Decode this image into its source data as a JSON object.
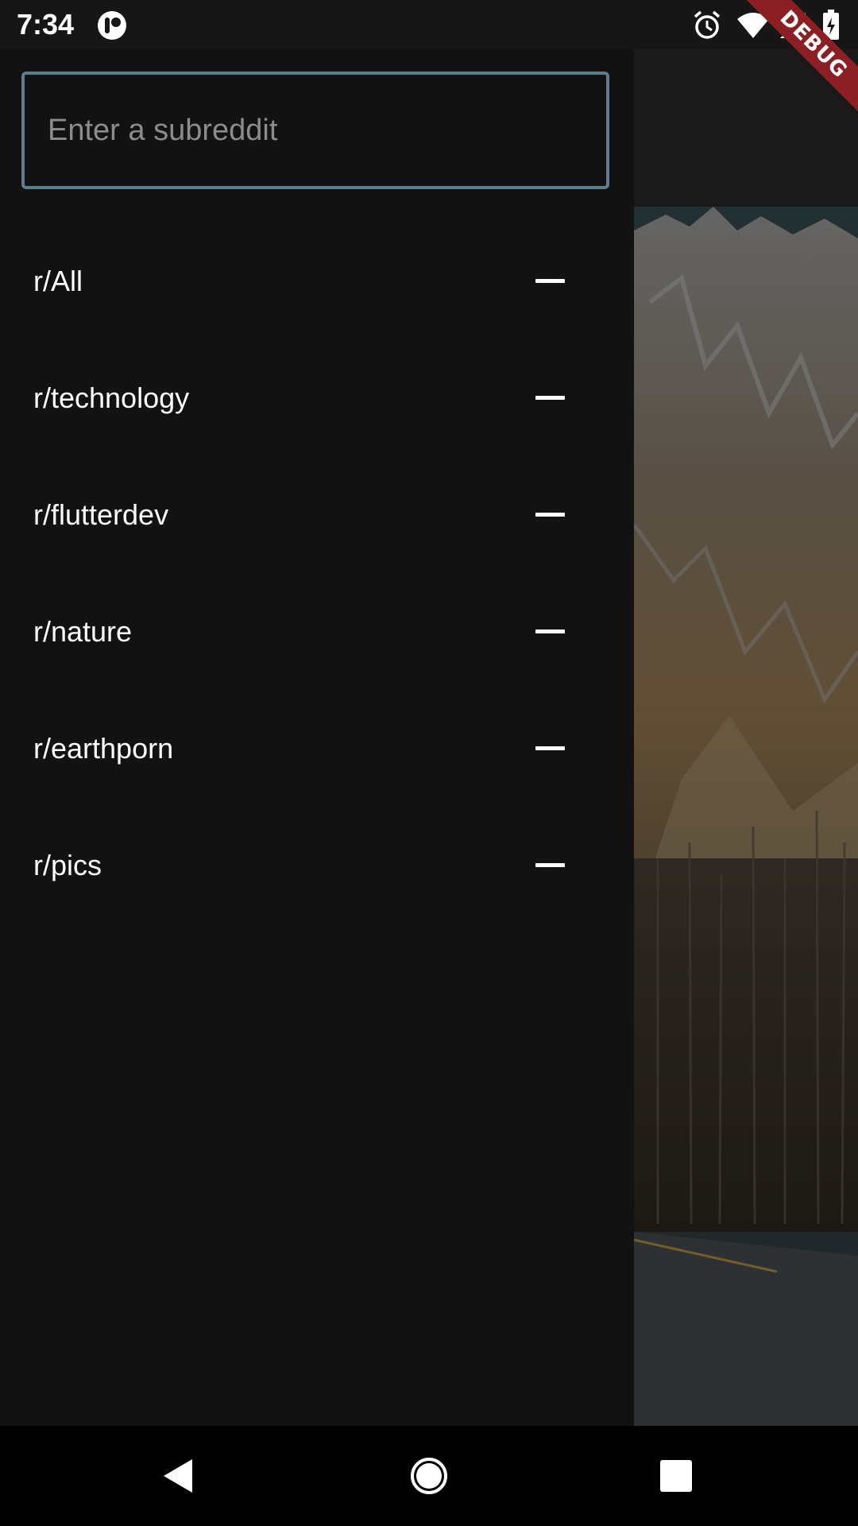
{
  "status_bar": {
    "time": "7:34",
    "icons": [
      "app-notification-icon",
      "alarm-icon",
      "wifi-icon",
      "signal-icon",
      "battery-charging-icon"
    ]
  },
  "debug_banner": {
    "label": "DEBUG",
    "color": "#8c1f24"
  },
  "drawer": {
    "search": {
      "placeholder": "Enter a subreddit",
      "value": "",
      "border_color": "#5d7e8c"
    },
    "subreddits": [
      {
        "label": "r/All",
        "action_icon": "remove-icon"
      },
      {
        "label": "r/technology",
        "action_icon": "remove-icon"
      },
      {
        "label": "r/flutterdev",
        "action_icon": "remove-icon"
      },
      {
        "label": "r/nature",
        "action_icon": "remove-icon"
      },
      {
        "label": "r/earthporn",
        "action_icon": "remove-icon"
      },
      {
        "label": "r/pics",
        "action_icon": "remove-icon"
      }
    ]
  },
  "nav_bar": {
    "buttons": [
      "back-icon",
      "home-icon",
      "recents-icon"
    ]
  }
}
